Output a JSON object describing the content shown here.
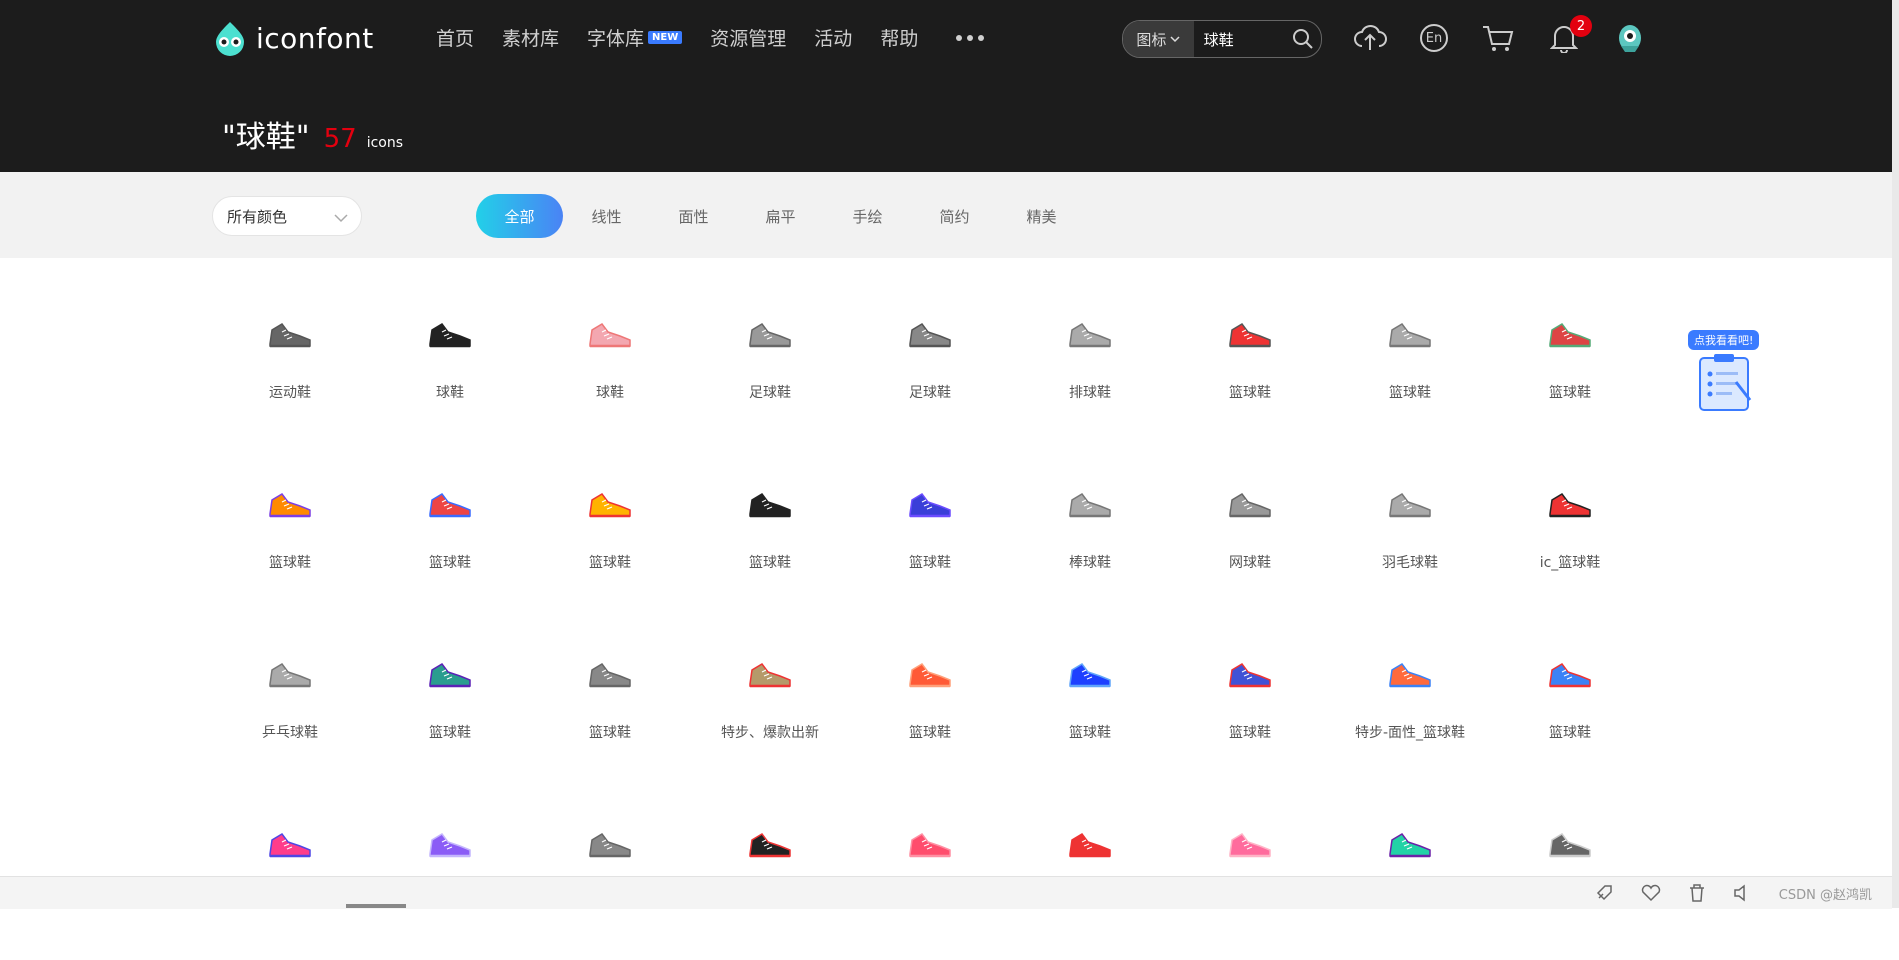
{
  "brand": {
    "name": "iconfont"
  },
  "nav": {
    "items": [
      "首页",
      "素材库",
      "字体库",
      "资源管理",
      "活动",
      "帮助"
    ],
    "font_badge": "NEW"
  },
  "search": {
    "type_label": "图标",
    "query": "球鞋"
  },
  "header_icons": {
    "lang": "En",
    "notification_count": "2"
  },
  "results": {
    "query_display": "\"球鞋\"",
    "count": "57",
    "unit": "icons"
  },
  "filters": {
    "color_select": "所有颜色",
    "tabs": [
      "全部",
      "线性",
      "面性",
      "扁平",
      "手绘",
      "简约",
      "精美"
    ],
    "active_tab": "全部"
  },
  "icons": {
    "row1": [
      "运动鞋",
      "球鞋",
      "球鞋",
      "足球鞋",
      "足球鞋",
      "排球鞋",
      "篮球鞋",
      "篮球鞋",
      "篮球鞋"
    ],
    "row2": [
      "篮球鞋",
      "篮球鞋",
      "篮球鞋",
      "篮球鞋",
      "篮球鞋",
      "棒球鞋",
      "网球鞋",
      "羽毛球鞋",
      "ic_篮球鞋"
    ],
    "row3": [
      "乒乓球鞋",
      "篮球鞋",
      "篮球鞋",
      "特步、爆款出新",
      "篮球鞋",
      "篮球鞋",
      "篮球鞋",
      "特步-面性_篮球鞋",
      "篮球鞋"
    ]
  },
  "promo": {
    "label": "点我看看吧!"
  },
  "footer": {
    "watermark": "CSDN @赵鸿凯"
  },
  "colors": {
    "header_bg": "#1c1c1c",
    "accent_count": "#e3000f",
    "tab_gradient_start": "#22d0e8",
    "tab_gradient_end": "#4a83f5"
  }
}
